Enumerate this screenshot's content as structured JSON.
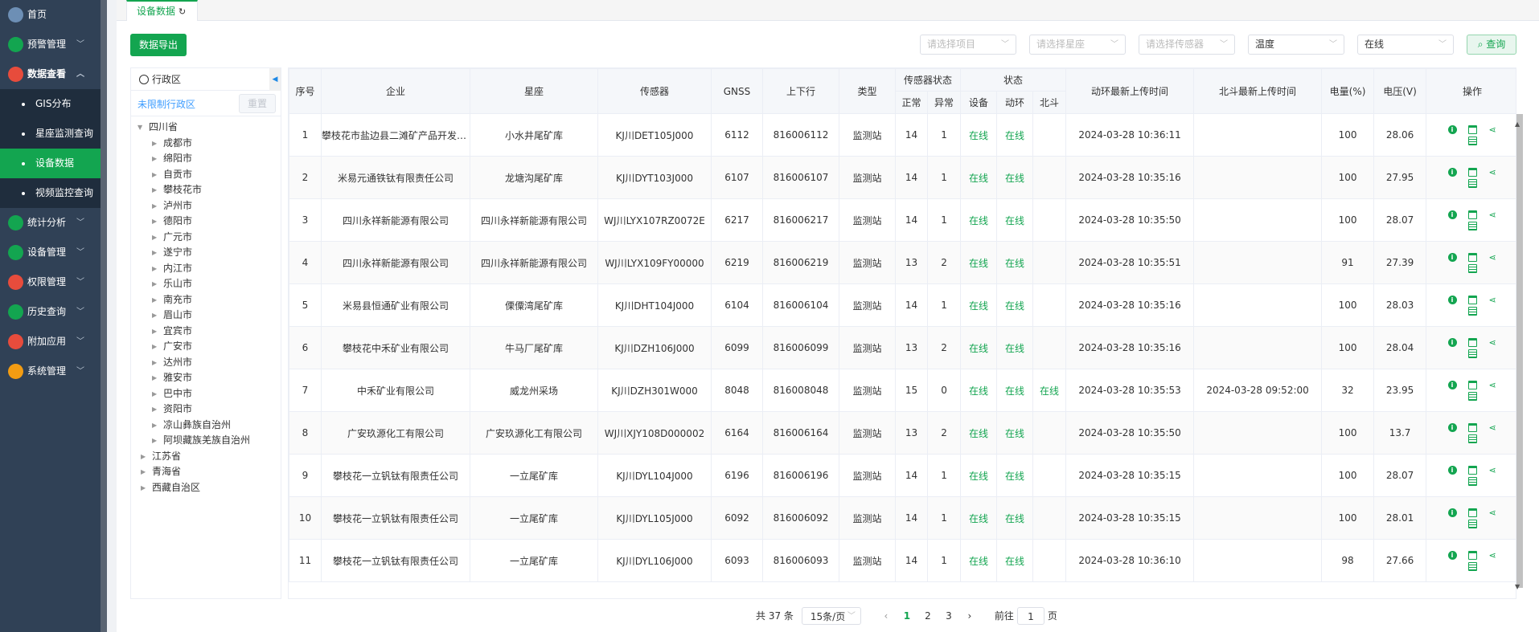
{
  "sidebar": {
    "items": [
      {
        "label": "首页",
        "icon": "home-icon",
        "color": "#6d8fb5"
      },
      {
        "label": "预警管理",
        "icon": "lightning-icon",
        "color": "#13a550"
      },
      {
        "label": "数据查看",
        "icon": "user-data-icon",
        "color": "#e74c3c"
      },
      {
        "label": "统计分析",
        "icon": "gear-stats-icon",
        "color": "#13a550"
      },
      {
        "label": "设备管理",
        "icon": "wrench-icon",
        "color": "#13a550"
      },
      {
        "label": "权限管理",
        "icon": "shield-check-icon",
        "color": "#e74c3c"
      },
      {
        "label": "历史查询",
        "icon": "history-icon",
        "color": "#13a550"
      },
      {
        "label": "附加应用",
        "icon": "app-icon",
        "color": "#e74c3c"
      },
      {
        "label": "系统管理",
        "icon": "settings-icon",
        "color": "#f39c12"
      }
    ],
    "sub_items": [
      "GIS分布",
      "星座监测查询",
      "设备数据",
      "视频监控查询"
    ]
  },
  "tabs": {
    "active": "设备数据"
  },
  "toolbar": {
    "export_label": "数据导出",
    "filters": [
      {
        "placeholder": "请选择项目",
        "value": ""
      },
      {
        "placeholder": "请选择星座",
        "value": ""
      },
      {
        "placeholder": "请选择传感器",
        "value": ""
      },
      {
        "placeholder": "",
        "value": "温度"
      },
      {
        "placeholder": "",
        "value": "在线"
      }
    ],
    "query_label": "查询"
  },
  "tree": {
    "header": "行政区",
    "unlimited_link": "未限制行政区",
    "reset_label": "重置",
    "root": "四川省",
    "children": [
      "成都市",
      "绵阳市",
      "自贡市",
      "攀枝花市",
      "泸州市",
      "德阳市",
      "广元市",
      "遂宁市",
      "内江市",
      "乐山市",
      "南充市",
      "眉山市",
      "宜宾市",
      "广安市",
      "达州市",
      "雅安市",
      "巴中市",
      "资阳市",
      "凉山彝族自治州",
      "阿坝藏族羌族自治州"
    ],
    "others": [
      "江苏省",
      "青海省",
      "西藏自治区"
    ]
  },
  "table": {
    "headers": {
      "index": "序号",
      "company": "企业",
      "constellation": "星座",
      "sensor": "传感器",
      "gnss": "GNSS",
      "updown": "上下行",
      "type": "类型",
      "sensor_status": "传感器状态",
      "normal": "正常",
      "abnormal": "异常",
      "status": "状态",
      "device": "设备",
      "env": "动环",
      "beidou": "北斗",
      "env_time": "动环最新上传时间",
      "beidou_time": "北斗最新上传时间",
      "battery": "电量(%)",
      "voltage": "电压(V)",
      "ops": "操作"
    },
    "rows": [
      {
        "idx": "1",
        "company": "攀枝花市盐边县二滩矿产品开发有限公司",
        "const": "小水井尾矿库",
        "sensor": "KJ川DET105J000",
        "gnss": "6112",
        "updown": "816006112",
        "type": "监测站",
        "normal": "14",
        "abnormal": "1",
        "device": "在线",
        "env": "在线",
        "beidou": "",
        "env_time": "2024-03-28 10:36:11",
        "bd_time": "",
        "battery": "100",
        "voltage": "28.06"
      },
      {
        "idx": "2",
        "company": "米易元通铁钛有限责任公司",
        "const": "龙塘沟尾矿库",
        "sensor": "KJ川DYT103J000",
        "gnss": "6107",
        "updown": "816006107",
        "type": "监测站",
        "normal": "14",
        "abnormal": "1",
        "device": "在线",
        "env": "在线",
        "beidou": "",
        "env_time": "2024-03-28 10:35:16",
        "bd_time": "",
        "battery": "100",
        "voltage": "27.95"
      },
      {
        "idx": "3",
        "company": "四川永祥新能源有限公司",
        "const": "四川永祥新能源有限公司",
        "sensor": "WJ川LYX107RZ0072E",
        "gnss": "6217",
        "updown": "816006217",
        "type": "监测站",
        "normal": "14",
        "abnormal": "1",
        "device": "在线",
        "env": "在线",
        "beidou": "",
        "env_time": "2024-03-28 10:35:50",
        "bd_time": "",
        "battery": "100",
        "voltage": "28.07"
      },
      {
        "idx": "4",
        "company": "四川永祥新能源有限公司",
        "const": "四川永祥新能源有限公司",
        "sensor": "WJ川LYX109FY00000",
        "gnss": "6219",
        "updown": "816006219",
        "type": "监测站",
        "normal": "13",
        "abnormal": "2",
        "device": "在线",
        "env": "在线",
        "beidou": "",
        "env_time": "2024-03-28 10:35:51",
        "bd_time": "",
        "battery": "91",
        "voltage": "27.39"
      },
      {
        "idx": "5",
        "company": "米易县恒通矿业有限公司",
        "const": "傈僳湾尾矿库",
        "sensor": "KJ川DHT104J000",
        "gnss": "6104",
        "updown": "816006104",
        "type": "监测站",
        "normal": "14",
        "abnormal": "1",
        "device": "在线",
        "env": "在线",
        "beidou": "",
        "env_time": "2024-03-28 10:35:16",
        "bd_time": "",
        "battery": "100",
        "voltage": "28.03"
      },
      {
        "idx": "6",
        "company": "攀枝花中禾矿业有限公司",
        "const": "牛马厂尾矿库",
        "sensor": "KJ川DZH106J000",
        "gnss": "6099",
        "updown": "816006099",
        "type": "监测站",
        "normal": "13",
        "abnormal": "2",
        "device": "在线",
        "env": "在线",
        "beidou": "",
        "env_time": "2024-03-28 10:35:16",
        "bd_time": "",
        "battery": "100",
        "voltage": "28.04"
      },
      {
        "idx": "7",
        "company": "中禾矿业有限公司",
        "const": "威龙州采场",
        "sensor": "KJ川DZH301W000",
        "gnss": "8048",
        "updown": "816008048",
        "type": "监测站",
        "normal": "15",
        "abnormal": "0",
        "device": "在线",
        "env": "在线",
        "beidou": "在线",
        "env_time": "2024-03-28 10:35:53",
        "bd_time": "2024-03-28 09:52:00",
        "battery": "32",
        "voltage": "23.95"
      },
      {
        "idx": "8",
        "company": "广安玖源化工有限公司",
        "const": "广安玖源化工有限公司",
        "sensor": "WJ川XJY108D000002",
        "gnss": "6164",
        "updown": "816006164",
        "type": "监测站",
        "normal": "13",
        "abnormal": "2",
        "device": "在线",
        "env": "在线",
        "beidou": "",
        "env_time": "2024-03-28 10:35:50",
        "bd_time": "",
        "battery": "100",
        "voltage": "13.7"
      },
      {
        "idx": "9",
        "company": "攀枝花一立钒钛有限责任公司",
        "const": "一立尾矿库",
        "sensor": "KJ川DYL104J000",
        "gnss": "6196",
        "updown": "816006196",
        "type": "监测站",
        "normal": "14",
        "abnormal": "1",
        "device": "在线",
        "env": "在线",
        "beidou": "",
        "env_time": "2024-03-28 10:35:15",
        "bd_time": "",
        "battery": "100",
        "voltage": "28.07"
      },
      {
        "idx": "10",
        "company": "攀枝花一立钒钛有限责任公司",
        "const": "一立尾矿库",
        "sensor": "KJ川DYL105J000",
        "gnss": "6092",
        "updown": "816006092",
        "type": "监测站",
        "normal": "14",
        "abnormal": "1",
        "device": "在线",
        "env": "在线",
        "beidou": "",
        "env_time": "2024-03-28 10:35:15",
        "bd_time": "",
        "battery": "100",
        "voltage": "28.01"
      },
      {
        "idx": "11",
        "company": "攀枝花一立钒钛有限责任公司",
        "const": "一立尾矿库",
        "sensor": "KJ川DYL106J000",
        "gnss": "6093",
        "updown": "816006093",
        "type": "监测站",
        "normal": "14",
        "abnormal": "1",
        "device": "在线",
        "env": "在线",
        "beidou": "",
        "env_time": "2024-03-28 10:36:10",
        "bd_time": "",
        "battery": "98",
        "voltage": "27.66"
      }
    ]
  },
  "pagination": {
    "total": "共 37 条",
    "page_size": "15条/页",
    "pages": [
      "1",
      "2",
      "3"
    ],
    "current": "1",
    "goto_prefix": "前往",
    "goto_value": "1",
    "goto_suffix": "页"
  },
  "colors": {
    "accent": "#13a550",
    "sidebar_bg": "#304156",
    "link": "#409eff"
  }
}
